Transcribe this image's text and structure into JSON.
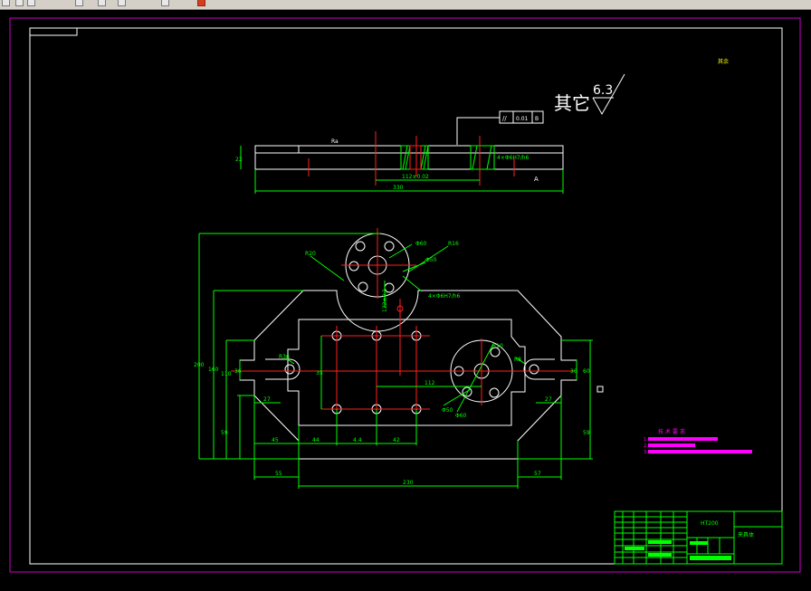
{
  "toolbar": {
    "buttons": [
      "refresh-icon",
      "undo-icon",
      "redo-icon",
      "save-icon",
      "copy-icon",
      "pan-icon",
      "crosshair-icon",
      "brush-icon"
    ]
  },
  "colors": {
    "background": "#000000",
    "frame": "#ffffff",
    "border": "#cc00cc",
    "dimension": "#00ff00",
    "centerline": "#ff2020",
    "highlight": "#ff00ff",
    "note": "#ffff00"
  },
  "drawing": {
    "roughness_other_label": "其它",
    "roughness_value": "6.3",
    "tolerance_symbol": "//",
    "tolerance_value": "0.01",
    "tolerance_datum": "B",
    "top_note": "其余",
    "side_view": {
      "thickness": "22",
      "length": "330",
      "center_distance": "112±0.02",
      "bore_note": "4×Φ6H7/h6",
      "roughness_mark": "Ra",
      "datum": "A"
    },
    "plan_view": {
      "dims_vertical": [
        "200",
        "160",
        "110",
        "36",
        "35",
        "60",
        "36",
        "59",
        "59"
      ],
      "dims_horizontal": [
        "27",
        "45",
        "44",
        "4.4",
        "42",
        "55",
        "230",
        "57",
        "27",
        "112"
      ],
      "labels": [
        "R20",
        "Φ60",
        "R16",
        "Φ50",
        "R36",
        "4×Φ6H7/h6",
        "122±0.1",
        "R8",
        "R10",
        "Φ50",
        "Φ60"
      ]
    },
    "tech_notes": {
      "title": "技 术 要 求",
      "lines": [
        "1.",
        "2.",
        "3. GB/T1184—K"
      ]
    },
    "title_block": {
      "material": "HT200",
      "part_name": "夹具体"
    }
  }
}
